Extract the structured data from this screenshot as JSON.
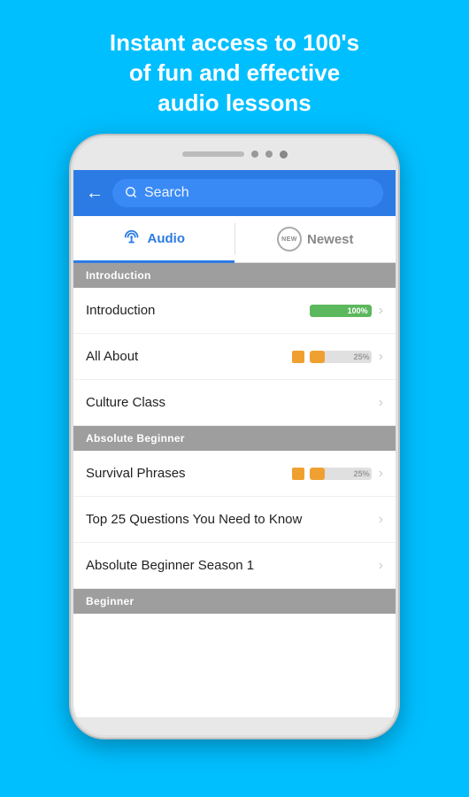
{
  "hero": {
    "line1": "Instant access to 100's",
    "line2": "of fun and effective",
    "line3": "audio lessons"
  },
  "topNav": {
    "backLabel": "←",
    "searchPlaceholder": "Search"
  },
  "tabs": [
    {
      "id": "audio",
      "label": "Audio",
      "active": true,
      "icon": "audio-icon"
    },
    {
      "id": "newest",
      "label": "Newest",
      "active": false,
      "icon": "new-badge-icon"
    }
  ],
  "sections": [
    {
      "header": "Introduction",
      "items": [
        {
          "title": "Introduction",
          "progress": 100,
          "progressColor": "green",
          "progressLabel": "100%",
          "hasProgress": true
        },
        {
          "title": "All About",
          "progress": 25,
          "progressColor": "orange",
          "progressLabel": "25%",
          "hasProgress": true
        },
        {
          "title": "Culture Class",
          "progress": 0,
          "hasProgress": false
        }
      ]
    },
    {
      "header": "Absolute Beginner",
      "items": [
        {
          "title": "Survival Phrases",
          "progress": 25,
          "progressColor": "orange",
          "progressLabel": "25%",
          "hasProgress": true
        },
        {
          "title": "Top 25 Questions You Need to Know",
          "progress": 0,
          "hasProgress": false
        },
        {
          "title": "Absolute Beginner Season 1",
          "progress": 0,
          "hasProgress": false
        }
      ]
    },
    {
      "header": "Beginner",
      "items": []
    }
  ],
  "colors": {
    "sky": "#00bfff",
    "navBlue": "#2c7be5",
    "sectionGray": "#9e9e9e",
    "progressGreen": "#5cb85c",
    "progressOrange": "#f0a030"
  }
}
